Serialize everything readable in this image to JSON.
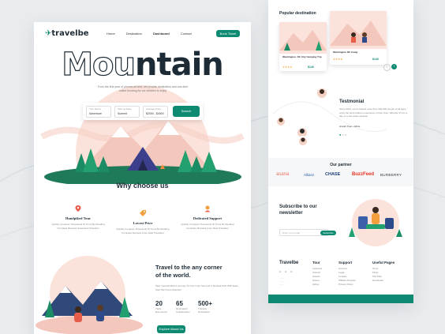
{
  "brand": {
    "logo": "travelbe"
  },
  "nav": {
    "links": [
      "Home",
      "Destination",
      "Dashboard",
      "Contact"
    ],
    "cta": "Book Ticket"
  },
  "hero": {
    "title_outline": "Mou",
    "title_solid": "ntain",
    "description": "From the first year of phones arrived, we provide destination and one-time online booking for our children to enjoy",
    "search": {
      "fields": [
        {
          "label": "Your Name",
          "value": "Adventure"
        },
        {
          "label": "Pick Up Date",
          "value": "Summit"
        },
        {
          "label": "Average Price",
          "value": "$2000 - $4000"
        }
      ],
      "button": "Search"
    }
  },
  "why": {
    "title": "Why choose us",
    "features": [
      {
        "title": "Handpiked Tour",
        "desc": "Quickly Compare Thousands Of Tours By Reading Complete Reviews Seasoned Travellers"
      },
      {
        "title": "Lowest Price",
        "desc": "Quickly Compare Thousands Of Tours By Reading Complete Reviews From Real Travellers"
      },
      {
        "title": "Dedicated Support",
        "desc": "Quickly Compare Thousands Of Tours By Reading Complete Reviews From Real Travellers"
      }
    ]
  },
  "travel": {
    "title_line1": "Travel to the any corner",
    "title_line2": "of the world.",
    "desc": "Take Yourself With A Journey To Your Inner Self And A Spiritual Path With Each Step We Focus Attention",
    "stats": [
      {
        "number": "20",
        "label": "Years Experience"
      },
      {
        "number": "65",
        "label": "Destination Collaboration"
      },
      {
        "number": "500+",
        "label": "Traveller Destination"
      }
    ],
    "cta": "Explore About Us"
  },
  "popular": {
    "title": "Popular destination",
    "card": {
      "name": "Washington, DC City Camping Trip",
      "price": "$140"
    },
    "card2": {
      "name": "Washington DC Camp",
      "price": "$140"
    }
  },
  "testimonial": {
    "title": "Testmonial",
    "quote": "Since 2014, we've helped more than 300,000 people of all ages enjoy the best outdoor experience of their lives. Whether it's for a day or a two week vacation.",
    "author": "Amrah Tyeo - Africa"
  },
  "partners": {
    "title": "Our partner",
    "names": [
      "asana",
      "Allianz",
      "CHASE",
      "BuzzFeed",
      "BURBERRY"
    ]
  },
  "newsletter": {
    "title_line1": "Subscribe to our",
    "title_line2": "newsletter",
    "placeholder": "Enter your email",
    "button": "Subscribe"
  },
  "footer": {
    "logo": "Travelbe",
    "columns": [
      {
        "title": "Tour",
        "items": [
          "Featured",
          "Historic",
          "Islands",
          "Nature",
          "Hiking"
        ]
      },
      {
        "title": "Support",
        "items": [
          "Account",
          "Legal",
          "Contact",
          "Affiliate Program",
          "Privacy Policy"
        ]
      },
      {
        "title": "Useful Pages",
        "items": [
          "Tours",
          "FAQs",
          "Site Map",
          "Newsletter"
        ]
      }
    ]
  }
}
